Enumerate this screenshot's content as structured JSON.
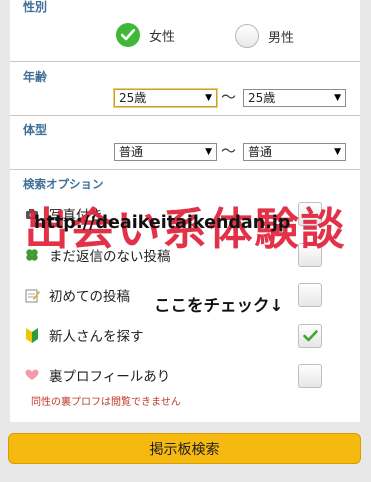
{
  "gender": {
    "label": "性別",
    "options": [
      {
        "label": "女性",
        "selected": true
      },
      {
        "label": "男性",
        "selected": false
      }
    ]
  },
  "age": {
    "label": "年齢",
    "from": "25歳",
    "separator": "〜",
    "to": "25歳"
  },
  "body_type": {
    "label": "体型",
    "from": "普通",
    "separator": "〜",
    "to": "普通"
  },
  "search_options": {
    "label": "検索オプション",
    "items": [
      {
        "label": "写真付き",
        "icon": "camera-icon",
        "checked": false
      },
      {
        "label": "まだ返信のない投稿",
        "icon": "clover-icon",
        "checked": false
      },
      {
        "label": "初めての投稿",
        "icon": "memo-icon",
        "checked": false
      },
      {
        "label": "新人さんを探す",
        "icon": "beginner-mark-icon",
        "checked": true
      },
      {
        "label": "裏プロフィールあり",
        "icon": "heart-icon",
        "checked": false
      }
    ],
    "note": "同性の裏プロフは閲覧できません"
  },
  "watermark": {
    "title": "出会い系体験談",
    "url": "http://deaikeitaikendan.jp"
  },
  "annotation": "ここをチェック↓",
  "search_button": "掲示板検索",
  "colors": {
    "accent_label": "#3f6f99",
    "radio_selected": "#3fb83a",
    "check_mark": "#3aa832",
    "note_red": "#c0392b",
    "watermark_red": "#e0213a",
    "button_yellow": "#f5b90f"
  }
}
